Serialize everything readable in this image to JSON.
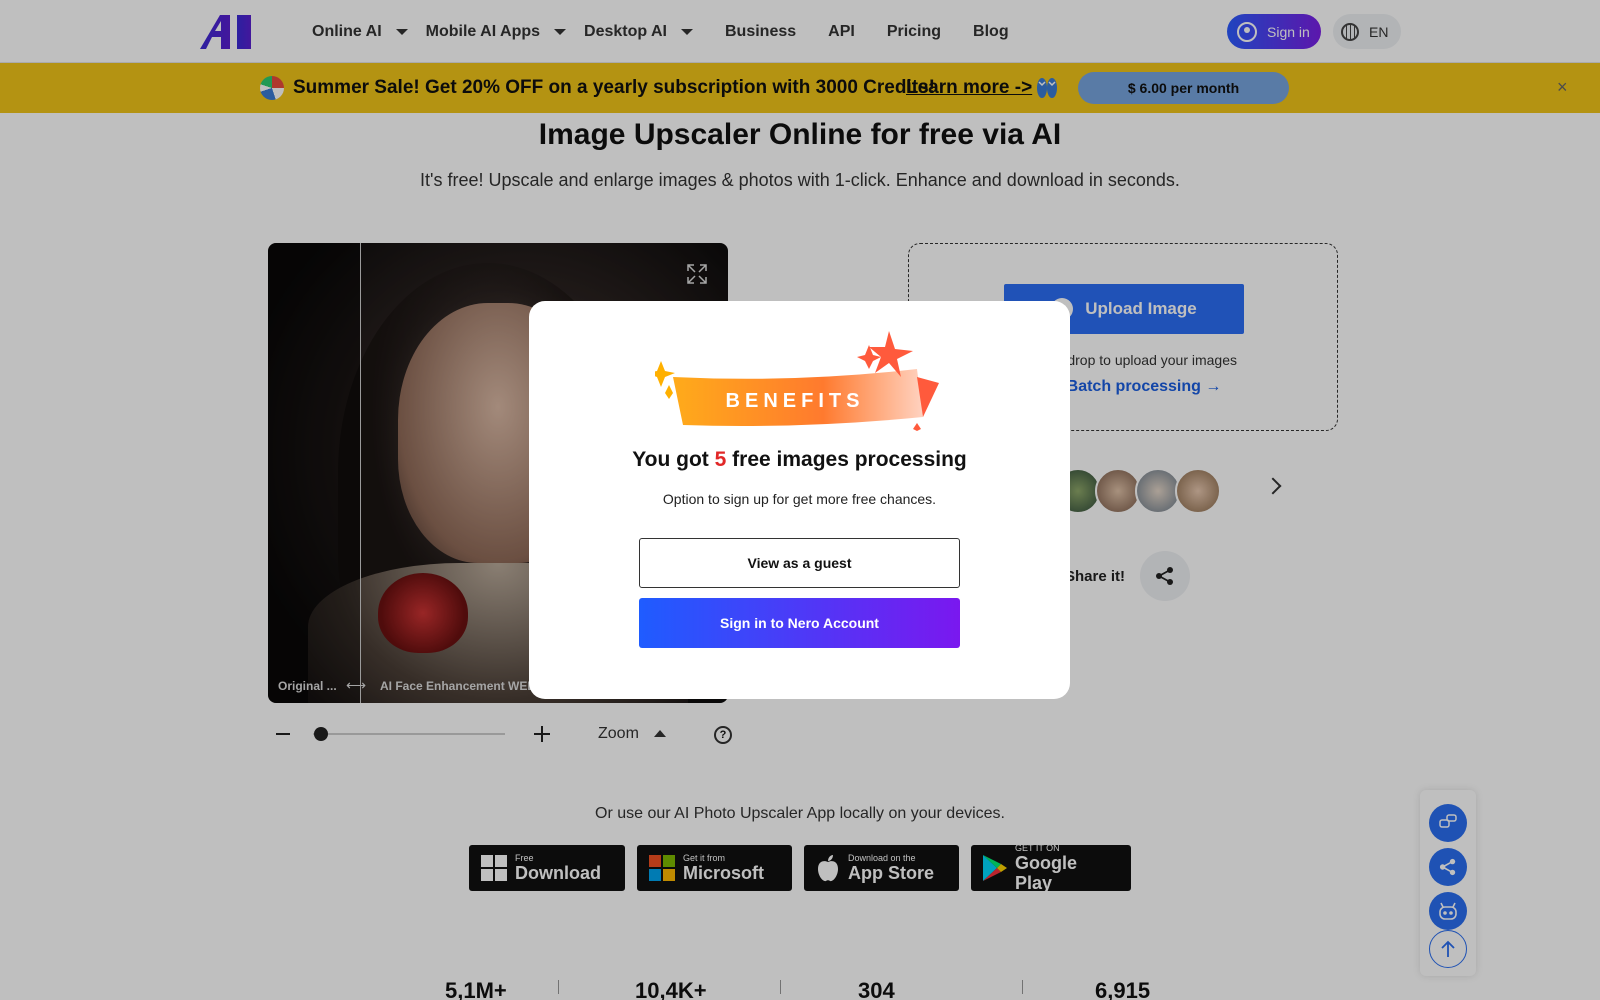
{
  "header": {
    "logo_text": "AI",
    "nav": [
      {
        "label": "Online AI",
        "dropdown": true
      },
      {
        "label": "Mobile AI Apps",
        "dropdown": true
      },
      {
        "label": "Desktop AI",
        "dropdown": true
      },
      {
        "label": "Business",
        "dropdown": false
      },
      {
        "label": "API",
        "dropdown": false
      },
      {
        "label": "Pricing",
        "dropdown": false
      },
      {
        "label": "Blog",
        "dropdown": false
      }
    ],
    "signin_label": "Sign in",
    "lang_label": "EN"
  },
  "banner": {
    "text": "Summer Sale! Get 20% OFF on a yearly subscription with 3000 Credits!",
    "link": "Learn more ->",
    "price_button": "$ 6.00 per month",
    "close": "×",
    "color": "#f0c419"
  },
  "main": {
    "title": "Image Upscaler Online for free via AI",
    "subtitle": "It's free! Upscale and enlarge images & photos with 1-click. Enhance and download in seconds.",
    "compare": {
      "left_label": "Original ...",
      "arrows": "⟷",
      "right_label": "AI Face Enhancement WEB..."
    },
    "zoom": {
      "label": "Zoom",
      "help": "?",
      "level": 0
    },
    "upload": {
      "button": "Upload Image",
      "drop_text": "or drop to upload your images",
      "batch": "Batch processing →"
    },
    "share_text": "Share it!",
    "local_text": "Or use our AI Photo Upscaler App locally on your devices.",
    "stores": [
      {
        "small": "Free",
        "large": "Download",
        "icon": "windows-icon"
      },
      {
        "small": "Get it from",
        "large": "Microsoft",
        "icon": "microsoft-icon"
      },
      {
        "small": "Download on the",
        "large": "App Store",
        "icon": "apple-icon"
      },
      {
        "small": "GET IT ON",
        "large": "Google Play",
        "icon": "google-play-icon"
      }
    ],
    "stats": [
      "5,1M+",
      "10,4K+",
      "304",
      "6,915"
    ]
  },
  "modal": {
    "badge": "BENEFITS",
    "headline_pre": "You got ",
    "headline_count": "5",
    "headline_post": " free images processing",
    "sub": "Option to sign up for get more free chances.",
    "guest_button": "View as a guest",
    "signin_button": "Sign in to Nero Account"
  },
  "colors": {
    "accent_blue": "#2b6ef5",
    "gradient_start": "#1f5cff",
    "gradient_end": "#7a18ef",
    "highlight_red": "#e12828"
  }
}
